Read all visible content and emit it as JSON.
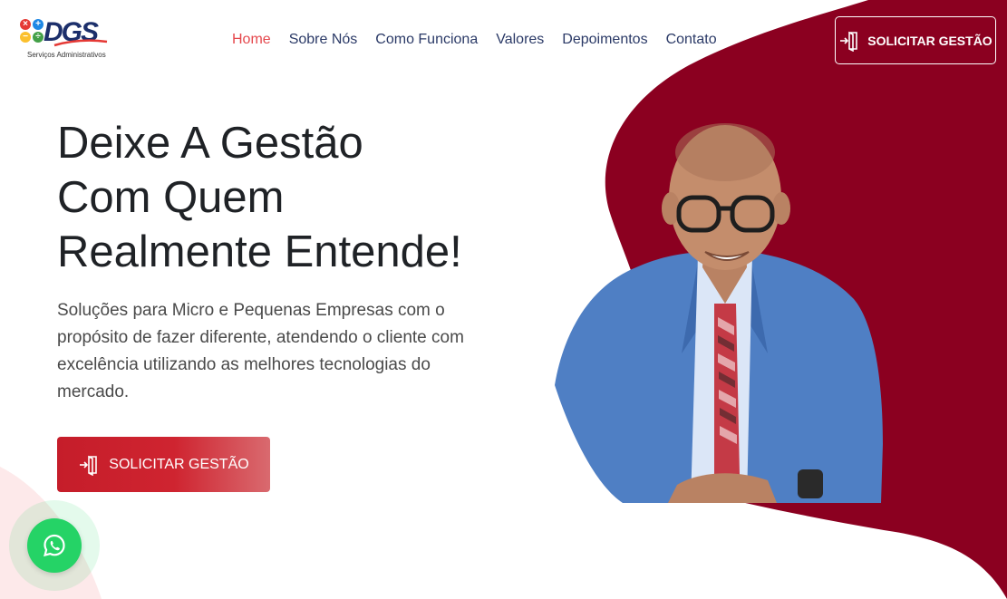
{
  "brand": {
    "logo_text": "DGS",
    "tagline": "Serviços Administrativos",
    "accent_color": "#8b0020",
    "highlight_color": "#e5484d",
    "cta_color": "#c51d2a",
    "whatsapp_color": "#25d366"
  },
  "nav": {
    "items": [
      {
        "label": "Home",
        "active": true
      },
      {
        "label": "Sobre Nós",
        "active": false
      },
      {
        "label": "Como Funciona",
        "active": false
      },
      {
        "label": "Valores",
        "active": false
      },
      {
        "label": "Depoimentos",
        "active": false
      },
      {
        "label": "Contato",
        "active": false
      }
    ]
  },
  "header_cta": {
    "label": "SOLICITAR GESTÃO",
    "icon": "login-door-icon"
  },
  "hero": {
    "title_lines": [
      "Deixe A Gestão",
      "Com Quem",
      "Realmente Entende!"
    ],
    "subtitle": "Soluções para Micro e Pequenas Empresas com o propósito de fazer diferente, atendendo o cliente com excelência utilizando as melhores tecnologias do mercado.",
    "cta_label": "SOLICITAR GESTÃO",
    "cta_icon": "login-door-icon",
    "photo_icon": "person-portrait"
  },
  "whatsapp": {
    "icon": "whatsapp-icon"
  }
}
